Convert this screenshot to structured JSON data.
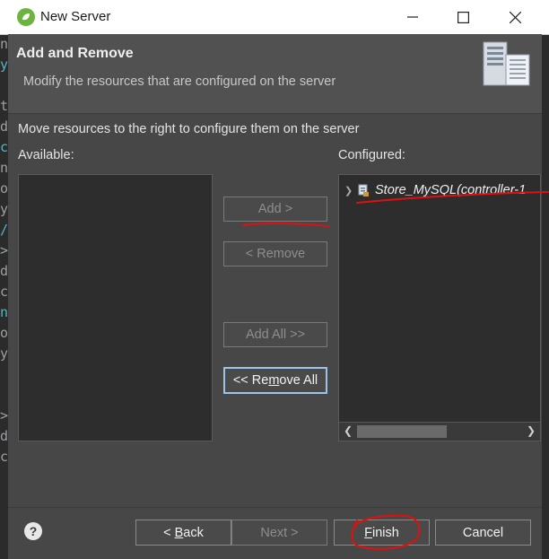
{
  "window": {
    "title": "New Server",
    "minimize_icon": "minimize-icon",
    "maximize_icon": "maximize-icon",
    "close_icon": "close-icon"
  },
  "header": {
    "title": "Add and Remove",
    "description": "Modify the resources that are configured on the server",
    "icon": "server-icon"
  },
  "instructions": "Move resources to the right to configure them on the server",
  "available": {
    "label": "Available:",
    "items": []
  },
  "configured": {
    "label": "Configured:",
    "items": [
      "Store_MySQL(controller-1"
    ]
  },
  "buttons": {
    "add": "Add >",
    "remove": "< Remove",
    "add_all": "Add All >>",
    "remove_all_prefix": "<< Re",
    "remove_all_mnemonic": "m",
    "remove_all_suffix": "ove All"
  },
  "footer": {
    "help_label": "?",
    "back_prefix": "< ",
    "back_mnemonic": "B",
    "back_suffix": "ack",
    "next": "Next >",
    "finish_mnemonic": "F",
    "finish_suffix": "inish",
    "cancel": "Cancel"
  },
  "background_strip": [
    "n",
    "y",
    "",
    "t",
    "d",
    "c",
    "n",
    "o",
    "y",
    "/",
    ">",
    "d",
    "c",
    "n",
    "o",
    "y",
    "",
    "",
    ">",
    "d",
    "c"
  ],
  "colors": {
    "dialog_bg": "#474747",
    "list_bg": "#2d2d2d",
    "focus_border": "#9ec3e8",
    "annotation_red": "#e01010"
  }
}
